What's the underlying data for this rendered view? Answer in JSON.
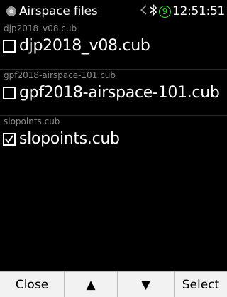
{
  "header": {
    "title": "Airspace files",
    "time": "12:51:51",
    "satellites": "9",
    "icons": [
      "airspace-app-icon",
      "share-icon",
      "bluetooth-icon",
      "gps-satellite-icon"
    ]
  },
  "files": [
    {
      "caption": "djp2018_v08.cub",
      "name": "djp2018_v08.cub",
      "checked": false
    },
    {
      "caption": "gpf2018-airspace-101.cub",
      "name": "gpf2018-airspace-101.cub",
      "checked": false
    },
    {
      "caption": "slopoints.cub",
      "name": "slopoints.cub",
      "checked": true
    }
  ],
  "buttons": {
    "close": "Close",
    "up": "▲",
    "down": "▼",
    "select": "Select"
  },
  "colors": {
    "background": "#000000",
    "text": "#ffffff",
    "caption": "#8a8a8a",
    "satellite_badge": "#4cd84c",
    "button_bar": "#f2f2f2"
  }
}
